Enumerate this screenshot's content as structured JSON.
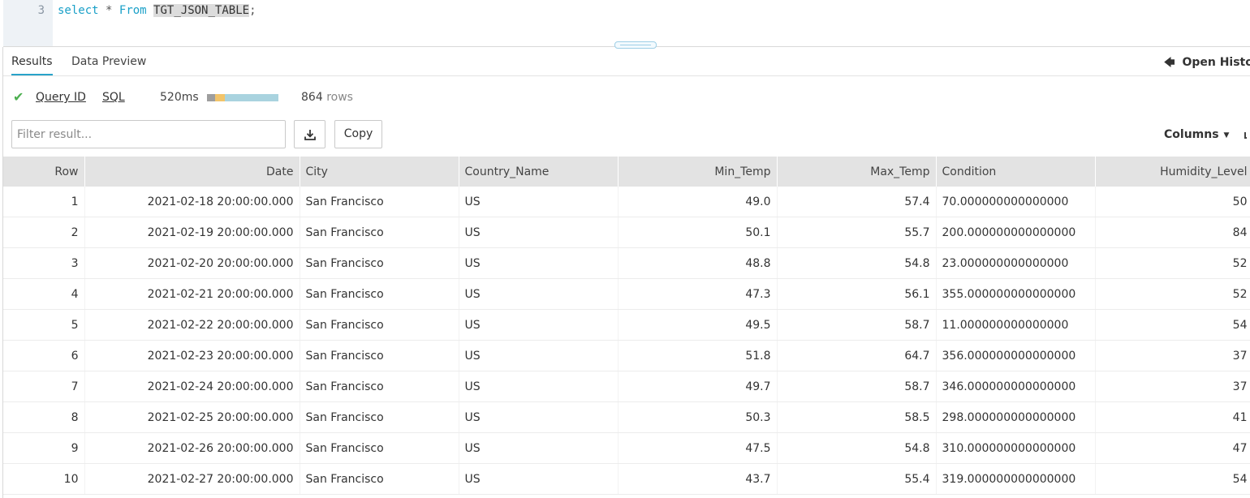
{
  "editor": {
    "line_number": "3",
    "tokens": {
      "kw_select": "select",
      "star": "*",
      "kw_from": "From",
      "table_name": "TGT_JSON_TABLE",
      "semicolon": ";"
    }
  },
  "tabs": [
    {
      "label": "Results",
      "active": true
    },
    {
      "label": "Data Preview",
      "active": false
    }
  ],
  "open_history": "Open Histor",
  "status": {
    "query_id": "Query ID",
    "sql": "SQL",
    "duration": "520ms",
    "rows_count": "864",
    "rows_label": "rows",
    "colors": {
      "success": "#4caf50",
      "bar_queued": "#9e9e9e",
      "bar_compile": "#f2c46a",
      "bar_exec": "#a9d3df"
    }
  },
  "toolbar": {
    "filter_placeholder": "Filter result...",
    "download_icon": "download-icon",
    "copy_label": "Copy",
    "columns_label": "Columns",
    "columns_caret": "▼"
  },
  "table": {
    "headers": [
      "Row",
      "Date",
      "City",
      "Country_Name",
      "Min_Temp",
      "Max_Temp",
      "Condition",
      "Humidity_Level"
    ],
    "rows": [
      [
        "1",
        "2021-02-18 20:00:00.000",
        "San Francisco",
        "US",
        "49.0",
        "57.4",
        "70.000000000000000",
        "50"
      ],
      [
        "2",
        "2021-02-19 20:00:00.000",
        "San Francisco",
        "US",
        "50.1",
        "55.7",
        "200.000000000000000",
        "84"
      ],
      [
        "3",
        "2021-02-20 20:00:00.000",
        "San Francisco",
        "US",
        "48.8",
        "54.8",
        "23.000000000000000",
        "52"
      ],
      [
        "4",
        "2021-02-21 20:00:00.000",
        "San Francisco",
        "US",
        "47.3",
        "56.1",
        "355.000000000000000",
        "52"
      ],
      [
        "5",
        "2021-02-22 20:00:00.000",
        "San Francisco",
        "US",
        "49.5",
        "58.7",
        "11.000000000000000",
        "54"
      ],
      [
        "6",
        "2021-02-23 20:00:00.000",
        "San Francisco",
        "US",
        "51.8",
        "64.7",
        "356.000000000000000",
        "37"
      ],
      [
        "7",
        "2021-02-24 20:00:00.000",
        "San Francisco",
        "US",
        "49.7",
        "58.7",
        "346.000000000000000",
        "37"
      ],
      [
        "8",
        "2021-02-25 20:00:00.000",
        "San Francisco",
        "US",
        "50.3",
        "58.5",
        "298.000000000000000",
        "41"
      ],
      [
        "9",
        "2021-02-26 20:00:00.000",
        "San Francisco",
        "US",
        "47.5",
        "54.8",
        "310.000000000000000",
        "47"
      ],
      [
        "10",
        "2021-02-27 20:00:00.000",
        "San Francisco",
        "US",
        "43.7",
        "55.4",
        "319.000000000000000",
        "54"
      ]
    ]
  }
}
